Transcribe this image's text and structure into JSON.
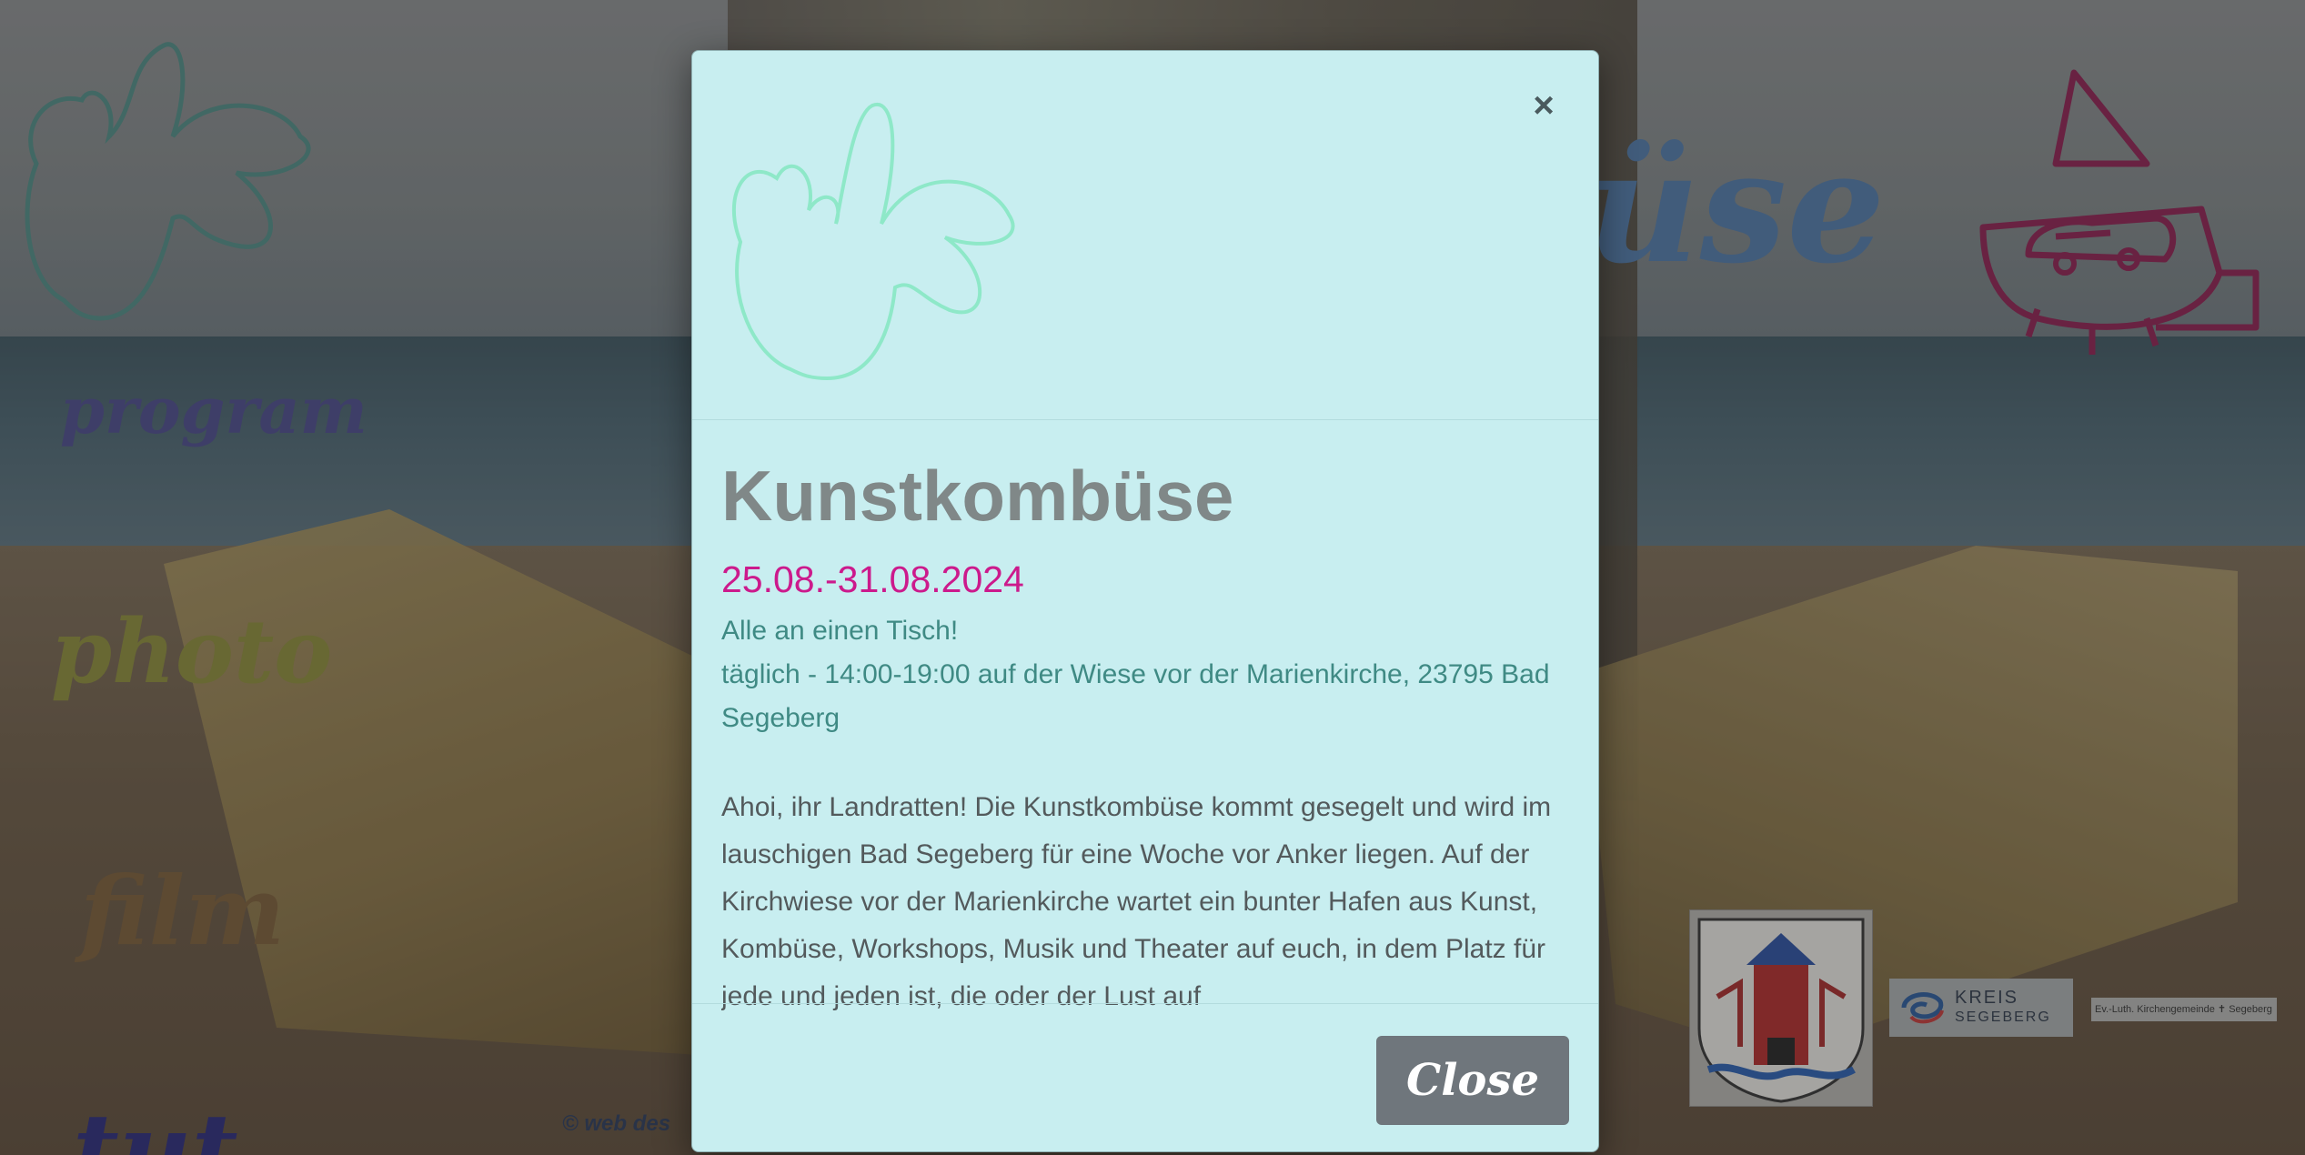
{
  "background": {
    "title_fragment": "üse",
    "nav": {
      "program": "program",
      "photo": "photo",
      "film": "film",
      "extra": "tut"
    },
    "copyright": "© web des",
    "logos": {
      "kreis_main": "KREIS",
      "kreis_sub": "SEGEBERG",
      "church": "Ev.-Luth. Kirchengemeinde ✝ Segeberg"
    }
  },
  "modal": {
    "close_icon": "×",
    "title": "Kunstkombüse",
    "date": "25.08.-31.08.2024",
    "subtitle": "Alle an einen Tisch!",
    "info": "täglich - 14:00-19:00 auf der Wiese vor der Marienkirche, 23795 Bad Segeberg",
    "description": "Ahoi, ihr Landratten! Die Kunstkombüse kommt gesegelt und wird im lauschigen Bad Segeberg für eine Woche vor Anker liegen. Auf der Kirchwiese vor der Marienkirche wartet ein bunter Hafen aus Kunst, Kombüse, Workshops, Musik und Theater auf euch, in dem Platz für jede und jeden ist, die oder der Lust auf",
    "close_label": "Close"
  },
  "colors": {
    "modal_bg": "#c8eef0",
    "title": "#808888",
    "date": "#cc1a8c",
    "info": "#3f8a84",
    "button": "#6f767c"
  },
  "icons": {
    "close": "close-icon",
    "splash": "splash-logo-icon",
    "ship": "ship-icon",
    "coat_of_arms": "coat-of-arms-icon"
  }
}
